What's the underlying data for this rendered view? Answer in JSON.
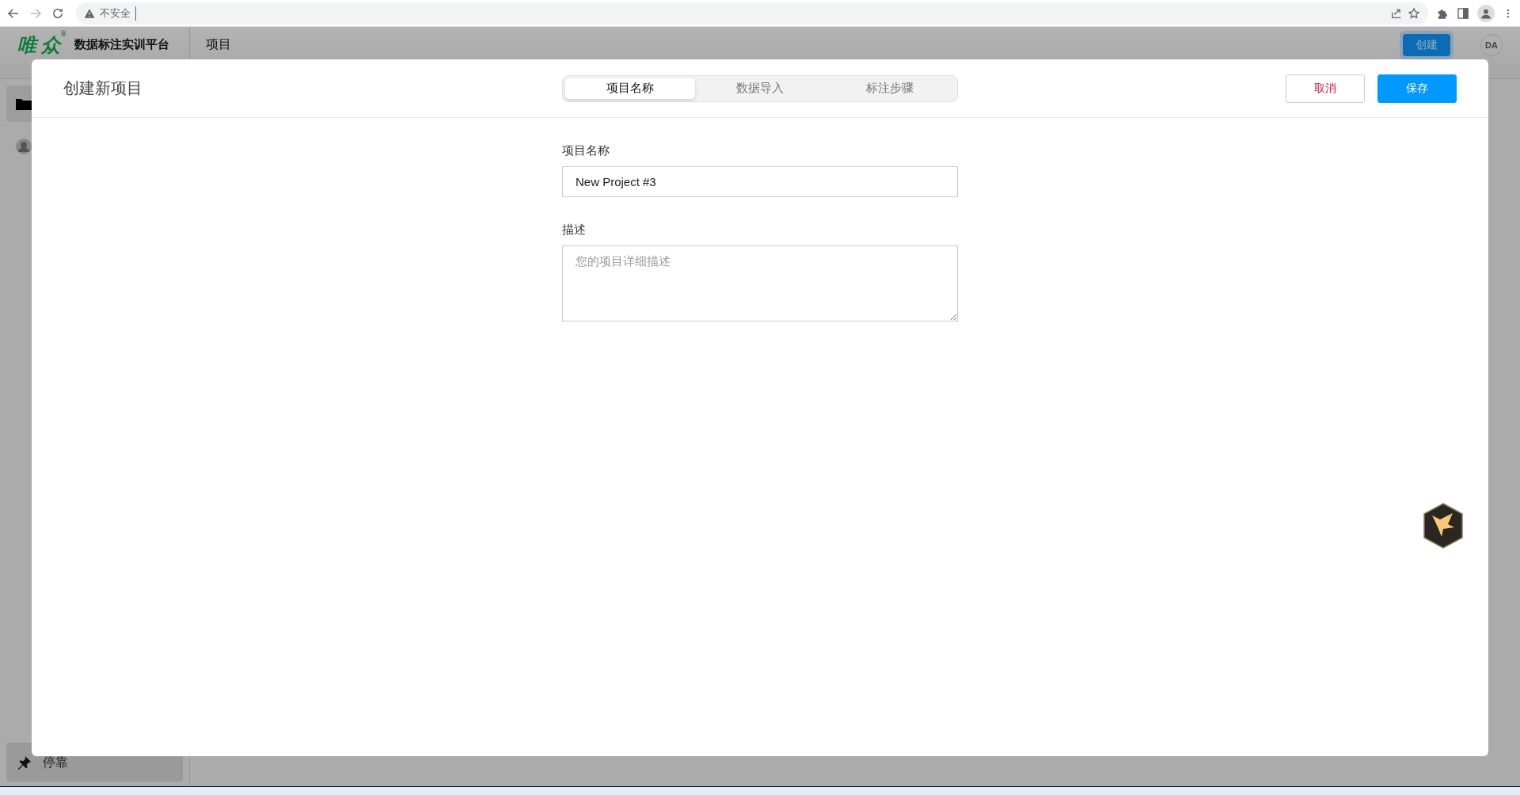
{
  "browser": {
    "security_label": "不安全"
  },
  "app": {
    "logo": "唯众",
    "logo_mark": "®",
    "platform_title": "数据标注实训平台",
    "section": "项目",
    "create_button": "创建",
    "avatar": "DA",
    "dock_label": "停靠"
  },
  "sidebar": {
    "items": [
      {
        "kind": "folder",
        "selected": true
      },
      {
        "kind": "user",
        "selected": false
      }
    ]
  },
  "dialog": {
    "title": "创建新项目",
    "tabs": [
      {
        "label": "项目名称",
        "selected": true
      },
      {
        "label": "数据导入",
        "selected": false
      },
      {
        "label": "标注步骤",
        "selected": false
      }
    ],
    "buttons": [
      {
        "kind": "cancel",
        "label": "取消"
      },
      {
        "kind": "save",
        "label": "保存"
      }
    ],
    "fields": [
      {
        "kind": "input",
        "label": "项目名称",
        "value": "New Project #3"
      },
      {
        "kind": "textarea",
        "label": "描述",
        "placeholder": "您的项目详细描述"
      }
    ]
  }
}
